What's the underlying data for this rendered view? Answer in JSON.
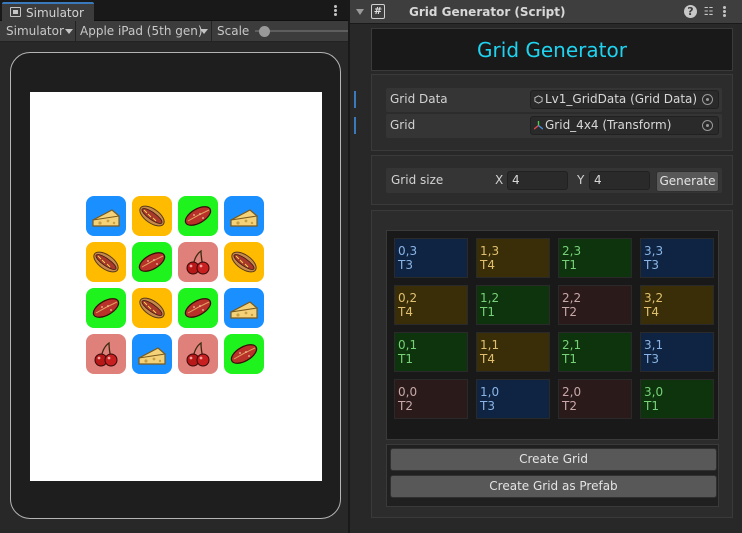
{
  "simulator": {
    "tab_label": "Simulator",
    "toolbar": {
      "mode_label": "Simulator",
      "device_label": "Apple iPad (5th gen)",
      "scale_label": "Scale"
    },
    "scale_level": 0.1,
    "board": [
      [
        "cheese",
        "hotdog",
        "sausage",
        "cheese"
      ],
      [
        "hotdog",
        "sausage",
        "cherry",
        "hotdog"
      ],
      [
        "sausage",
        "hotdog",
        "sausage",
        "cheese"
      ],
      [
        "cherry",
        "cheese",
        "cherry",
        "sausage"
      ]
    ]
  },
  "colors": {
    "tile_cheese": "#1a8fff",
    "tile_hotdog": "#ffbb00",
    "tile_sausage": "#1ef31e",
    "tile_cherry": "#e0807a",
    "title_text": "#1fd3f0",
    "cell_T1": "#0d340d",
    "cell_T2": "#2a1a1a",
    "cell_T3": "#0e2442",
    "cell_T4": "#3a2e08",
    "text_T1": "#78d078",
    "text_T2": "#c8a8a8",
    "text_T3": "#8ab4e6",
    "text_T4": "#e0c070"
  },
  "inspector": {
    "header_title": "Grid Generator (Script)",
    "script_icon": "#",
    "help_icon": "?",
    "presets_icon": "☷",
    "menu_icon": "kebab-icon",
    "title": "Grid Generator",
    "grid_data_label": "Grid Data",
    "grid_data_value": "Lv1_GridData (Grid Data)",
    "grid_label": "Grid",
    "grid_value": "Grid_4x4 (Transform)",
    "grid_size_label": "Grid size",
    "x_label": "X",
    "x_value": "4",
    "y_label": "Y",
    "y_value": "4",
    "generate_label": "Generate",
    "cells": [
      [
        {
          "coord": "0,3",
          "type": "T3"
        },
        {
          "coord": "1,3",
          "type": "T4"
        },
        {
          "coord": "2,3",
          "type": "T1"
        },
        {
          "coord": "3,3",
          "type": "T3"
        }
      ],
      [
        {
          "coord": "0,2",
          "type": "T4"
        },
        {
          "coord": "1,2",
          "type": "T1"
        },
        {
          "coord": "2,2",
          "type": "T2"
        },
        {
          "coord": "3,2",
          "type": "T4"
        }
      ],
      [
        {
          "coord": "0,1",
          "type": "T1"
        },
        {
          "coord": "1,1",
          "type": "T4"
        },
        {
          "coord": "2,1",
          "type": "T1"
        },
        {
          "coord": "3,1",
          "type": "T3"
        }
      ],
      [
        {
          "coord": "0,0",
          "type": "T2"
        },
        {
          "coord": "1,0",
          "type": "T3"
        },
        {
          "coord": "2,0",
          "type": "T2"
        },
        {
          "coord": "3,0",
          "type": "T1"
        }
      ]
    ],
    "create_grid_label": "Create Grid",
    "create_prefab_label": "Create Grid as Prefab"
  }
}
